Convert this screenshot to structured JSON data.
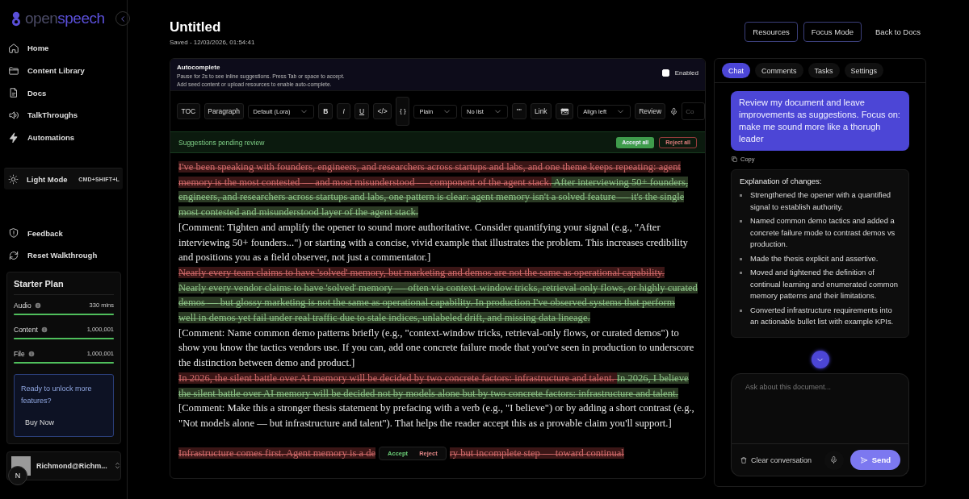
{
  "sidebar": {
    "logo": {
      "prefix": "open",
      "suffix": "speech"
    },
    "nav": [
      {
        "label": "Home"
      },
      {
        "label": "Content Library"
      },
      {
        "label": "Docs"
      },
      {
        "label": "TalkThroughs"
      },
      {
        "label": "Automations"
      }
    ],
    "theme_toggle": {
      "label": "Light Mode",
      "shortcut": "CMD+SHIFT+L"
    },
    "footer_nav": [
      {
        "label": "Feedback"
      },
      {
        "label": "Reset Walkthrough"
      }
    ],
    "plan": {
      "title": "Starter Plan",
      "usage": [
        {
          "name": "Audio",
          "value": "330 mins",
          "level": 1
        },
        {
          "name": "Content",
          "value": "1,000,001",
          "level": 1
        },
        {
          "name": "File",
          "value": "1,000,001",
          "level": 1
        }
      ],
      "upgrade": {
        "text": "Ready to unlock more features?",
        "button": "Buy Now"
      }
    },
    "user": {
      "name": "Richmond@Richm...",
      "badge": "N"
    }
  },
  "header": {
    "title": "Untitled",
    "saved": "Saved - 12/03/2026, 01:54:41",
    "buttons": [
      {
        "label": "Resources",
        "kind": "outlined"
      },
      {
        "label": "Focus Mode",
        "kind": "outlined"
      },
      {
        "label": "Back to Docs",
        "kind": "plain"
      }
    ]
  },
  "editor": {
    "autocomplete": {
      "title": "Autocomplete",
      "lines": [
        "Pause for 2s to see inline suggestions. Press Tab or space to accept.",
        "Add seed content or upload resources to enable auto-complete."
      ],
      "toggle_label": "Enabled",
      "enabled": false
    },
    "toolbar": [
      {
        "kind": "button",
        "label": "TOC"
      },
      {
        "kind": "button",
        "label": "Paragraph"
      },
      {
        "kind": "select",
        "label": "Default (Lora)"
      },
      {
        "kind": "bold",
        "label": "B"
      },
      {
        "kind": "italic",
        "label": "I"
      },
      {
        "kind": "underline",
        "label": "U"
      },
      {
        "kind": "button",
        "label": "</>"
      },
      {
        "kind": "brace",
        "label": "{ }"
      },
      {
        "kind": "select",
        "label": "Plain"
      },
      {
        "kind": "select",
        "label": "No list"
      },
      {
        "kind": "button",
        "label": "\"\""
      },
      {
        "kind": "button",
        "label": "Link"
      },
      {
        "kind": "image"
      },
      {
        "kind": "select",
        "label": "Align left"
      },
      {
        "kind": "button",
        "label": "Review"
      },
      {
        "kind": "mic"
      },
      {
        "kind": "field",
        "label": "Co"
      }
    ],
    "review_bar": {
      "label": "Suggestions pending review",
      "accept_all": "Accept all",
      "reject_all": "Reject all"
    },
    "blocks": [
      {
        "kind": "suggestion",
        "lines": [
          [
            {
              "kind": "deleted",
              "text": "I've been speaking with founders, engineers, and researchers across startups and labs, and one theme keeps repeating: agent"
            }
          ],
          [
            {
              "kind": "deleted",
              "text": "memory is the most contested — and most misunderstood — component of the agent stack."
            },
            {
              "kind": "inserted",
              "text": " After interviewing 50+ founders,"
            }
          ],
          [
            {
              "kind": "inserted",
              "text": "engineers, and researchers across startups and labs, one pattern is clear: agent memory isn't a solved feature — it's the single"
            }
          ],
          [
            {
              "kind": "inserted",
              "text": "most contested and misunderstood layer of the agent stack."
            }
          ]
        ]
      },
      {
        "kind": "comment",
        "text": "[Comment: Tighten and amplify the opener to sound more authoritative. Consider quantifying your signal (e.g., \"After interviewing 50+ founders...\") or starting with a concise, vivid example that illustrates the problem. This increases credibility and positions you as a field observer, not just a commentator.]"
      },
      {
        "kind": "suggestion",
        "lines": [
          [
            {
              "kind": "deleted",
              "text": " Nearly every team claims to have 'solved' memory, but marketing and demos are not the same as operational capability. "
            }
          ],
          [
            {
              "kind": "inserted",
              "text": "Nearly every vendor claims to have 'solved' memory — often via context-window tricks, retrieval-only flows, or highly curated"
            }
          ],
          [
            {
              "kind": "inserted",
              "text": "demos — but glossy marketing is not the same as operational capability. In production I've observed systems that perform"
            }
          ],
          [
            {
              "kind": "inserted",
              "text": "well in demos yet fail under real traffic due to stale indices, unlabeled drift, and missing data lineage."
            }
          ]
        ]
      },
      {
        "kind": "comment",
        "text": "[Comment: Name common demo patterns briefly (e.g., \"context-window tricks, retrieval-only flows, or curated demos\") to show you know the tactics vendors use. If you can, add one concrete failure mode that you've seen in production to underscore the distinction between demo and product.]"
      },
      {
        "kind": "suggestion",
        "lines": [
          [
            {
              "kind": "deleted",
              "text": " In 2026, the silent battle over AI memory will be decided by two concrete factors: infrastructure and talent. "
            },
            {
              "kind": "inserted",
              "text": " In 2026, I believe"
            }
          ],
          [
            {
              "kind": "inserted",
              "text": "the silent battle over AI memory will be decided not by models alone but by two concrete factors: infrastructure and talent."
            }
          ]
        ]
      },
      {
        "kind": "comment",
        "text": "[Comment: Make this a stronger thesis statement by prefacing with a verb (e.g., \"I believe\") or by adding a short contrast (e.g., \"Not models alone — but infrastructure and talent\"). That helps the reader accept this as a provable claim you'll support.]"
      },
      {
        "kind": "suggestion",
        "lines": [
          [
            {
              "kind": "deleted",
              "text": "Infrastructure comes first. Agent memory is a de"
            },
            {
              "kind": "popup",
              "accept": "Accept",
              "reject": "Reject"
            },
            {
              "kind": "deleted",
              "text": "ry but incomplete step — toward continual"
            }
          ]
        ]
      }
    ]
  },
  "chat": {
    "tabs": [
      {
        "label": "Chat",
        "selected": true
      },
      {
        "label": "Comments",
        "selected": false
      },
      {
        "label": "Tasks",
        "selected": false
      },
      {
        "label": "Settings",
        "selected": false
      }
    ],
    "user_message": "Review my document and leave improvements as suggestions. Focus on: make me sound more like a thorugh leader",
    "copy": "Copy",
    "reply": {
      "title": "Explanation of changes:",
      "bullets": [
        "Strengthened the opener with a quantified signal to establish authority.",
        "Named common demo tactics and added a concrete failure mode to contrast demos vs production.",
        "Made the thesis explicit and assertive.",
        "Moved and tightened the definition of continual learning and enumerated common memory patterns and their limitations.",
        "Converted infrastructure requirements into an actionable bullet list with example KPIs."
      ]
    },
    "input": {
      "placeholder": "Ask about this document..."
    },
    "clear": "Clear conversation",
    "send": "Send"
  }
}
